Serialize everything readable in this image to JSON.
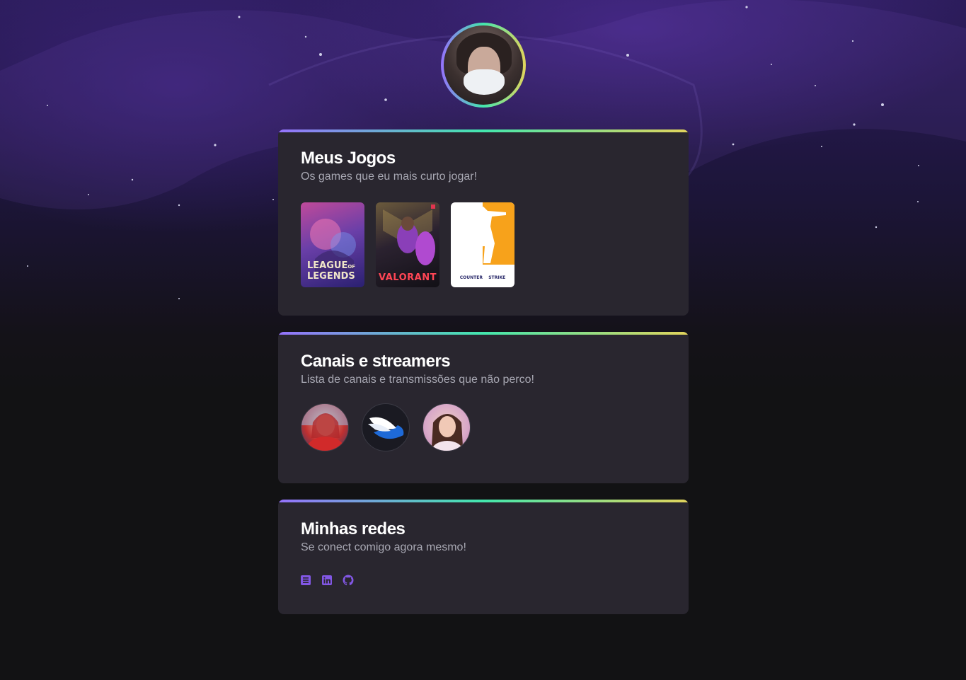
{
  "theme": {
    "accent_gradient": [
      "#9572fc",
      "#43e7ad",
      "#e2d45c"
    ],
    "card_background": "#29262f",
    "page_background": "#121214",
    "icon_color": "#8257e5"
  },
  "profile": {
    "avatar_icon": "profile-avatar"
  },
  "games_section": {
    "title": "Meus Jogos",
    "subtitle": "Os games que eu mais curto jogar!",
    "games": [
      {
        "name_line1": "LEAGUE",
        "name_line1_suffix": "OF",
        "name_line2": "LEGENDS"
      },
      {
        "name": "VALORANT"
      },
      {
        "name_left": "COUNTER",
        "name_right": "STRIKE"
      }
    ]
  },
  "streamers_section": {
    "title": "Canais e streamers",
    "subtitle": "Lista de canais e transmissões que não perco!",
    "streamers": [
      {
        "icon": "streamer-avatar"
      },
      {
        "icon": "winged-shoe-logo"
      },
      {
        "icon": "streamer-avatar"
      }
    ]
  },
  "social_section": {
    "title": "Minhas redes",
    "subtitle": "Se conect comigo agora mesmo!",
    "links": [
      {
        "icon": "instagram-icon"
      },
      {
        "icon": "linkedin-icon"
      },
      {
        "icon": "github-icon"
      }
    ]
  }
}
